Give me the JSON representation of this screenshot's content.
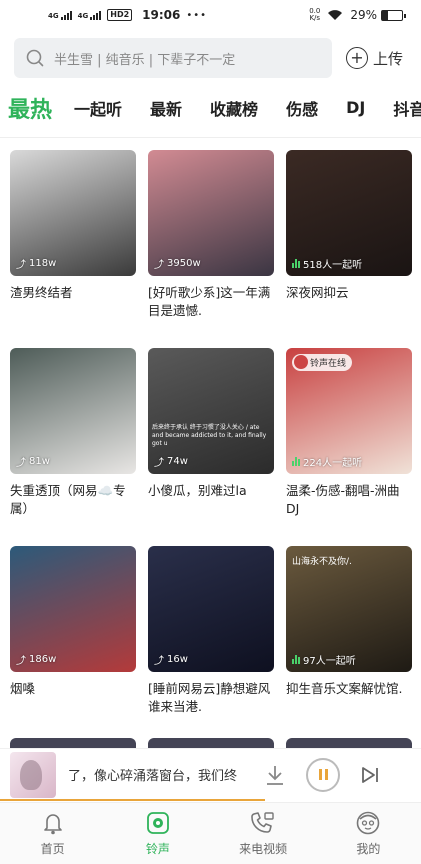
{
  "status_bar": {
    "network1": "4G",
    "network2": "4G",
    "hd": "HD2",
    "time": "19:06",
    "dots": "•••",
    "net_speed_top": "0.0",
    "net_speed_bottom": "K/s",
    "battery_percent": "29%"
  },
  "search": {
    "placeholder": "半生雪 | 纯音乐 | 下辈子不一定",
    "upload_label": "上传"
  },
  "tabs": [
    "最热",
    "一起听",
    "最新",
    "收藏榜",
    "伤感",
    "DJ",
    "抖音"
  ],
  "cards": [
    {
      "title": "渣男终结者",
      "count": "118w",
      "kind": "plays",
      "colors": [
        "#d9d9d9",
        "#3a3a3a"
      ]
    },
    {
      "title": "[好听歌少系]这一年满目是遗憾.",
      "count": "3950w",
      "kind": "plays",
      "colors": [
        "#d28b93",
        "#3a3542"
      ]
    },
    {
      "title": "深夜网抑云",
      "count": "518人一起听",
      "kind": "listen",
      "colors": [
        "#3b2a24",
        "#1a1413"
      ]
    },
    {
      "title": "失重透顶（网易☁️专属）",
      "count": "81w",
      "kind": "plays",
      "colors": [
        "#4e5c58",
        "#e8e6e4"
      ]
    },
    {
      "title": "小傻瓜，别难过la",
      "count": "74w",
      "kind": "plays",
      "colors": [
        "#5a5a5a",
        "#2b2b2b"
      ],
      "overlay": "后来终于承认 终于习惯了没人关心 / ate and became addicted to it, and finally got u"
    },
    {
      "title": "温柔-伤感-翻唱-洲曲DJ",
      "count": "224人一起听",
      "kind": "listen",
      "colors": [
        "#c84040",
        "#f0e2d8"
      ],
      "badge": "铃声在线"
    },
    {
      "title": "烟嗓",
      "count": "186w",
      "kind": "plays",
      "colors": [
        "#2c5a7a",
        "#b43a3a"
      ]
    },
    {
      "title": "[睡前网易云]静想避风 谁来当港.",
      "count": "16w",
      "kind": "plays",
      "colors": [
        "#2a2f4a",
        "#0e1020"
      ]
    },
    {
      "title": "抑生音乐文案解忧馆.",
      "count": "97人一起听",
      "kind": "listen",
      "colors": [
        "#6b5a3e",
        "#1e1a14"
      ],
      "top_text": "山海永不及你/."
    }
  ],
  "player": {
    "lyric": "了，像心碎涌落窗台，我们终"
  },
  "bottom_nav": [
    {
      "label": "首页",
      "icon": "bell-icon"
    },
    {
      "label": "铃声",
      "icon": "ringtone-icon",
      "active": true
    },
    {
      "label": "来电视频",
      "icon": "phone-video-icon"
    },
    {
      "label": "我的",
      "icon": "profile-icon"
    }
  ],
  "colors": {
    "accent": "#2fb35a",
    "player_accent": "#e9a53a"
  }
}
